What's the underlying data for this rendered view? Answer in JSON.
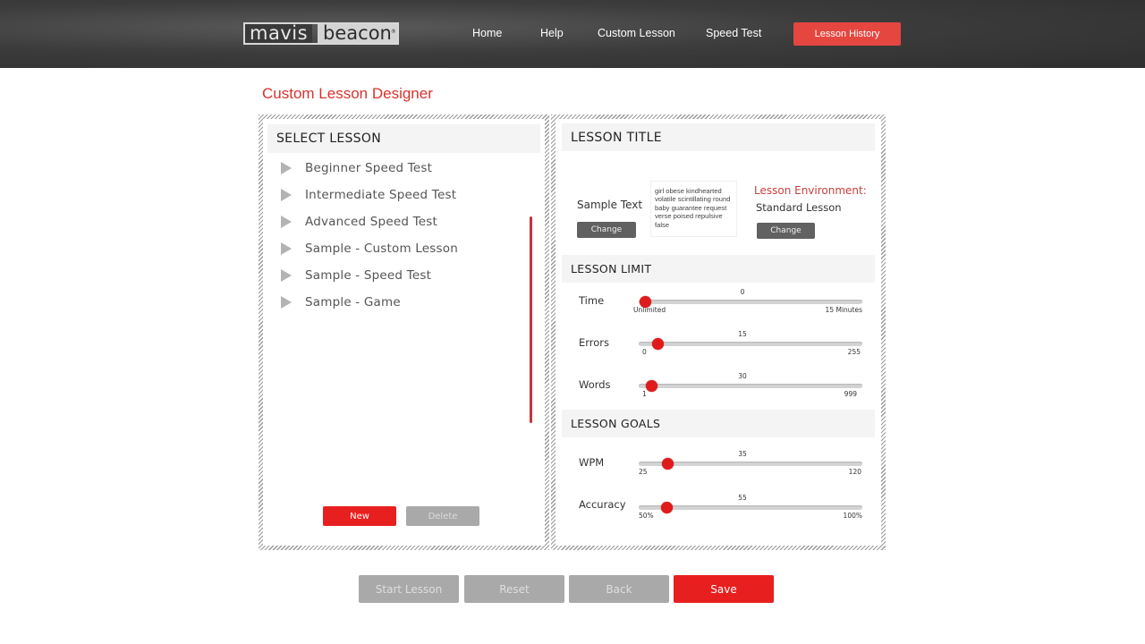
{
  "header": {
    "logo": {
      "part1": "mavis",
      "part2": "beacon",
      "reg": "®"
    },
    "nav": [
      {
        "label": "Home"
      },
      {
        "label": "Help"
      },
      {
        "label": "Custom Lesson"
      },
      {
        "label": "Speed Test"
      },
      {
        "label": "Lesson History",
        "active": true
      }
    ]
  },
  "page": {
    "title": "Custom Lesson Designer"
  },
  "select_lesson": {
    "heading": "SELECT LESSON",
    "items": [
      {
        "label": "Beginner Speed Test"
      },
      {
        "label": "Intermediate Speed Test"
      },
      {
        "label": "Advanced Speed Test"
      },
      {
        "label": "Sample - Custom Lesson"
      },
      {
        "label": "Sample - Speed Test"
      },
      {
        "label": "Sample - Game"
      }
    ],
    "new_label": "New",
    "delete_label": "Delete"
  },
  "lesson_title": {
    "heading": "LESSON TITLE",
    "sample_text_label": "Sample Text",
    "sample_text": "girl obese kindhearted volatile scintillating round baby guarantee request verse poised repulsive false",
    "sample_change_label": "Change",
    "environment_label": "Lesson Environment:",
    "environment_value": "Standard Lesson",
    "environment_change_label": "Change"
  },
  "lesson_limit": {
    "heading": "LESSON LIMIT",
    "sliders": [
      {
        "label": "Time",
        "value": "0",
        "min": "Unlimited",
        "max": "15 Minutes",
        "fraction": 0.0
      },
      {
        "label": "Errors",
        "value": "15",
        "min": "0",
        "max": "255",
        "fraction": 0.06
      },
      {
        "label": "Words",
        "value": "30",
        "min": "1",
        "max": "999",
        "fraction": 0.03
      }
    ]
  },
  "lesson_goals": {
    "heading": "LESSON GOALS",
    "sliders": [
      {
        "label": "WPM",
        "value": "35",
        "min": "25",
        "max": "120",
        "fraction": 0.105
      },
      {
        "label": "Accuracy",
        "value": "55",
        "min": "50%",
        "max": "100%",
        "fraction": 0.1
      }
    ]
  },
  "footer": {
    "start_label": "Start Lesson",
    "reset_label": "Reset",
    "back_label": "Back",
    "save_label": "Save"
  },
  "colors": {
    "accent": "#e81f1f",
    "disabled": "#a9a9a9",
    "dark_button": "#616161"
  }
}
